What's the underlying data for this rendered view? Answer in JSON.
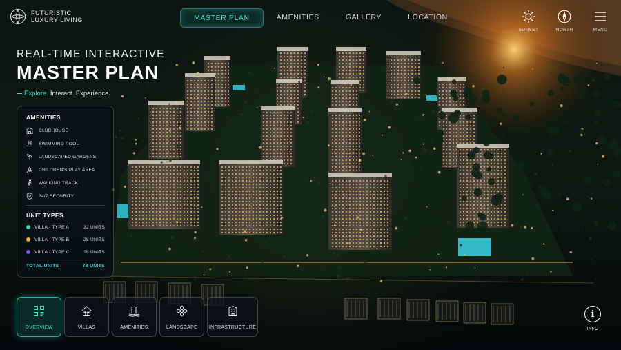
{
  "brand": {
    "line1": "FUTURISTIC",
    "line2": "LUXURY LIVING"
  },
  "nav": [
    {
      "label": "MASTER PLAN",
      "active": true
    },
    {
      "label": "AMENITIES",
      "active": false
    },
    {
      "label": "GALLERY",
      "active": false
    },
    {
      "label": "LOCATION",
      "active": false
    }
  ],
  "top_icons": [
    {
      "label": "SUNSET",
      "icon": "sun-icon"
    },
    {
      "label": "NORTH",
      "icon": "compass-icon"
    },
    {
      "label": "MENU",
      "icon": "hamburger-icon"
    }
  ],
  "hero": {
    "subtitle": "REAL-TIME INTERACTIVE",
    "title": "MASTER PLAN",
    "tag_highlight": "Explore.",
    "tag_rest": "Interact. Experience."
  },
  "amenities": {
    "heading": "AMENITIES",
    "items": [
      {
        "label": "CLUBHOUSE",
        "icon": "building-icon"
      },
      {
        "label": "SWIMMING POOL",
        "icon": "pool-icon"
      },
      {
        "label": "LANDSCAPED GARDENS",
        "icon": "garden-icon"
      },
      {
        "label": "CHILDREN'S PLAY AREA",
        "icon": "playground-icon"
      },
      {
        "label": "WALKING TRACK",
        "icon": "walking-icon"
      },
      {
        "label": "24/7 SECURITY",
        "icon": "shield-icon"
      }
    ]
  },
  "unit_types": {
    "heading": "UNIT TYPES",
    "items": [
      {
        "label": "VILLA - TYPE A",
        "count": "32 UNITS",
        "color": "#2bd0c0"
      },
      {
        "label": "VILLA - TYPE B",
        "count": "28 UNITS",
        "color": "#f2b230"
      },
      {
        "label": "VILLA - TYPE C",
        "count": "18 UNITS",
        "color": "#8a4fe0"
      }
    ],
    "total_label": "TOTAL UNITS",
    "total_count": "78 UNITS"
  },
  "tabs": [
    {
      "label": "OVERVIEW",
      "icon": "grid-icon",
      "active": true
    },
    {
      "label": "VILLAS",
      "icon": "house-icon",
      "active": false
    },
    {
      "label": "AMENITIES",
      "icon": "pool-ladder-icon",
      "active": false
    },
    {
      "label": "LANDSCAPE",
      "icon": "flower-icon",
      "active": false
    },
    {
      "label": "INFRASTRUCTURE",
      "icon": "building-icon",
      "active": false
    }
  ],
  "info": {
    "label": "INFO",
    "glyph": "i"
  },
  "colors": {
    "accent": "#35e0d0",
    "total": "#35d6f0"
  }
}
